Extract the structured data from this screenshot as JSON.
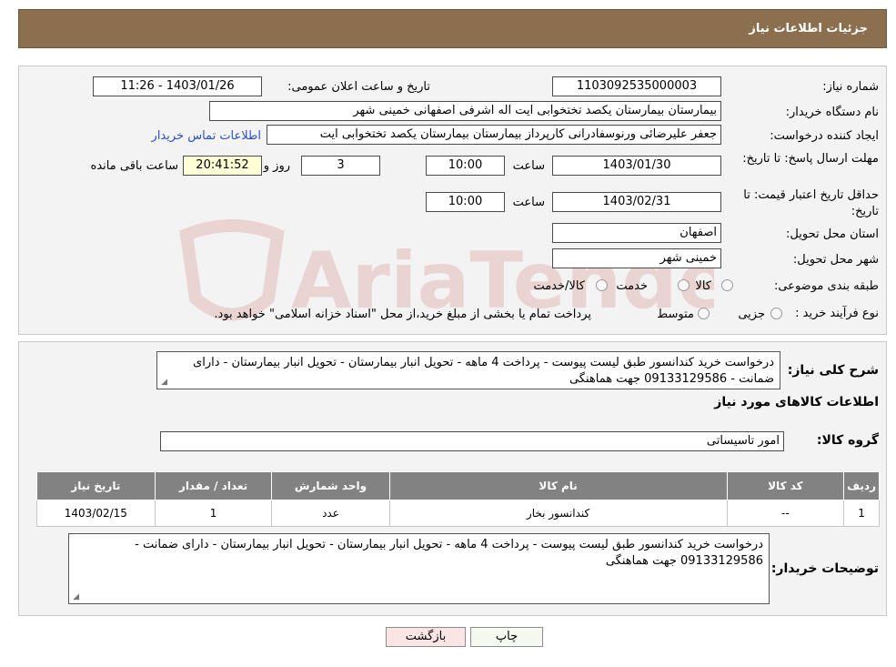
{
  "header": {
    "title": "جزئیات اطلاعات نیاز"
  },
  "info": {
    "need_number_label": "شماره نیاز:",
    "need_number": "1103092535000003",
    "announce_label": "تاریخ و ساعت اعلان عمومی:",
    "announce_value": "1403/01/26 - 11:26",
    "buyer_org_label": "نام دستگاه خریدار:",
    "buyer_org": "بیمارستان بیمارستان یکصد تختخوابی ایت اله اشرفی اصفهانی خمینی شهر",
    "creator_label": "ایجاد کننده درخواست:",
    "creator": "جعفر علیرضائی ورنوسفادرانی کارپرداز بیمارستان بیمارستان یکصد تختخوابی ایت",
    "contact_link": "اطلاعات تماس خریدار",
    "deadline_label": "مهلت ارسال پاسخ: تا تاریخ:",
    "deadline_date": "1403/01/30",
    "time_label": "ساعت",
    "deadline_time": "10:00",
    "days_value": "3",
    "days_label": "روز و",
    "remaining_time": "20:41:52",
    "remaining_label": "ساعت باقی مانده",
    "price_valid_label": "حداقل تاریخ اعتبار قیمت: تا تاریخ:",
    "price_valid_date": "1403/02/31",
    "price_valid_time": "10:00",
    "province_label": "استان محل تحویل:",
    "province": "اصفهان",
    "city_label": "شهر محل تحویل:",
    "city": "خمینی شهر",
    "category_label": "طبقه بندی موضوعی:",
    "category_options": [
      "کالا",
      "خدمت",
      "کالا/خدمت"
    ],
    "process_label": "نوع فرآیند خرید :",
    "process_options": [
      "جزیی",
      "متوسط"
    ],
    "process_note": "پرداخت تمام یا بخشی از مبلغ خرید،از محل \"اسناد خزانه اسلامی\" خواهد بود."
  },
  "details": {
    "desc_label": "شرح کلی نیاز:",
    "description": "درخواست خرید کندانسور طبق لیست پیوست - پرداخت 4 ماهه - تحویل انبار بیمارستان - تحویل انبار بیمارستان - دارای ضمانت - 09133129586 جهت هماهنگی",
    "goods_info_title": "اطلاعات کالاهای مورد نیاز",
    "goods_group_label": "گروه کالا:",
    "goods_group": "امور تاسیساتی",
    "table": {
      "headers": [
        "ردیف",
        "کد کالا",
        "نام کالا",
        "واحد شمارش",
        "تعداد / مقدار",
        "تاریخ نیاز"
      ],
      "rows": [
        [
          "1",
          "--",
          "کندانسور بخار",
          "عدد",
          "1",
          "1403/02/15"
        ]
      ]
    },
    "buyer_notes_label": "توضیحات خریدار:",
    "buyer_notes": "درخواست خرید کندانسور طبق لیست پیوست - پرداخت 4 ماهه - تحویل انبار بیمارستان - تحویل انبار بیمارستان - دارای ضمانت - 09133129586 جهت هماهنگی"
  },
  "buttons": {
    "print": "چاپ",
    "back": "بازگشت"
  },
  "watermark": {
    "text": "AriaTender.neT"
  }
}
